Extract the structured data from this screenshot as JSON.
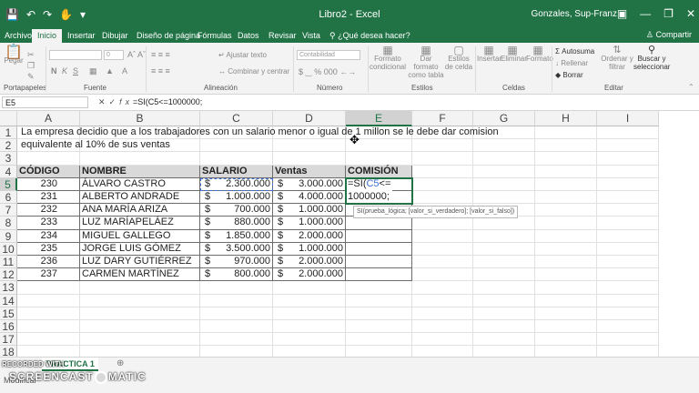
{
  "window": {
    "title": "Libro2 - Excel",
    "user": "Gonzales, Sup-Franz",
    "qat_icons": [
      "save-icon",
      "undo-icon",
      "redo-icon",
      "touch-mode-icon",
      "customize-icon"
    ]
  },
  "tabs": [
    "Archivo",
    "Inicio",
    "Insertar",
    "Dibujar",
    "Diseño de página",
    "Fórmulas",
    "Datos",
    "Revisar",
    "Vista"
  ],
  "active_tab": "Inicio",
  "tell_me": "¿Qué desea hacer?",
  "share_label": "Compartir",
  "ribbon": {
    "paste_label": "Pegar",
    "group_clipboard": "Portapapeles",
    "group_font": "Fuente",
    "group_alignment": "Alineación",
    "group_number": "Número",
    "group_styles": "Estilos",
    "group_cells": "Celdas",
    "group_editing": "Editar",
    "font_size": "0",
    "wrap_text": "Ajustar texto",
    "merge_center": "Combinar y centrar",
    "number_format": "Contabilidad",
    "cond_format": "Formato condicional",
    "format_table": "Dar formato como tabla",
    "cell_styles": "Estilos de celda",
    "insert": "Insertar",
    "delete": "Eliminar",
    "format": "Formato",
    "autosum": "Autosuma",
    "fill": "Rellenar",
    "clear": "Borrar",
    "sort_filter": "Ordenar y filtrar",
    "find_select": "Buscar y seleccionar"
  },
  "formula_bar": {
    "name_box": "E5",
    "formula": "=SI(C5<=1000000;"
  },
  "sheet": {
    "columns": [
      "A",
      "B",
      "C",
      "D",
      "E",
      "F",
      "G",
      "H",
      "I"
    ],
    "rows": [
      "1",
      "2",
      "3",
      "4",
      "5",
      "6",
      "7",
      "8",
      "9",
      "10",
      "11",
      "12",
      "13",
      "14",
      "15",
      "16",
      "17",
      "18"
    ],
    "selected_col": "E",
    "selected_row": "5",
    "intro_line1": "La empresa decidio que a los trabajadores con un salario menor o igual de 1 millon se le debe dar comision",
    "intro_line2": "equivalente al 10% de sus ventas",
    "headers": [
      "CÓDIGO",
      "NOMBRE",
      "SALARIO",
      "Ventas",
      "COMISIÓN"
    ],
    "currency_symbol": "$",
    "records": [
      {
        "code": "230",
        "name": "ÁLVARO CASTRO",
        "salary": "2.300.000",
        "sales": "3.000.000"
      },
      {
        "code": "231",
        "name": "ALBERTO ANDRADE",
        "salary": "1.000.000",
        "sales": "4.000.000"
      },
      {
        "code": "232",
        "name": "ANA MARÍA ARIZA",
        "salary": "700.000",
        "sales": "1.000.000"
      },
      {
        "code": "233",
        "name": "LUZ MARÍAPELÁEZ",
        "salary": "880.000",
        "sales": "1.000.000"
      },
      {
        "code": "234",
        "name": "MIGUEL GALLEGO",
        "salary": "1.850.000",
        "sales": "2.000.000"
      },
      {
        "code": "235",
        "name": "JORGE LUIS GÓMEZ",
        "salary": "3.500.000",
        "sales": "1.000.000"
      },
      {
        "code": "236",
        "name": "LUZ DARY GUTIÉRREZ",
        "salary": "970.000",
        "sales": "2.000.000"
      },
      {
        "code": "237",
        "name": "CARMEN  MARTÍNEZ",
        "salary": "800.000",
        "sales": "2.000.000"
      }
    ],
    "edit_prefix": "=SI(",
    "edit_ref": "C5",
    "edit_op": "<=",
    "edit_line2": "1000000;",
    "tooltip": "SI(prueba_lógica; [valor_si_verdadero]; [valor_si_falso])"
  },
  "sheet_tab": "PRACTICA 1",
  "watermark": {
    "line1": "RECORDED WITH",
    "line2a": "SCREENCAST",
    "line2b": "MATIC"
  },
  "status": "Modificar"
}
